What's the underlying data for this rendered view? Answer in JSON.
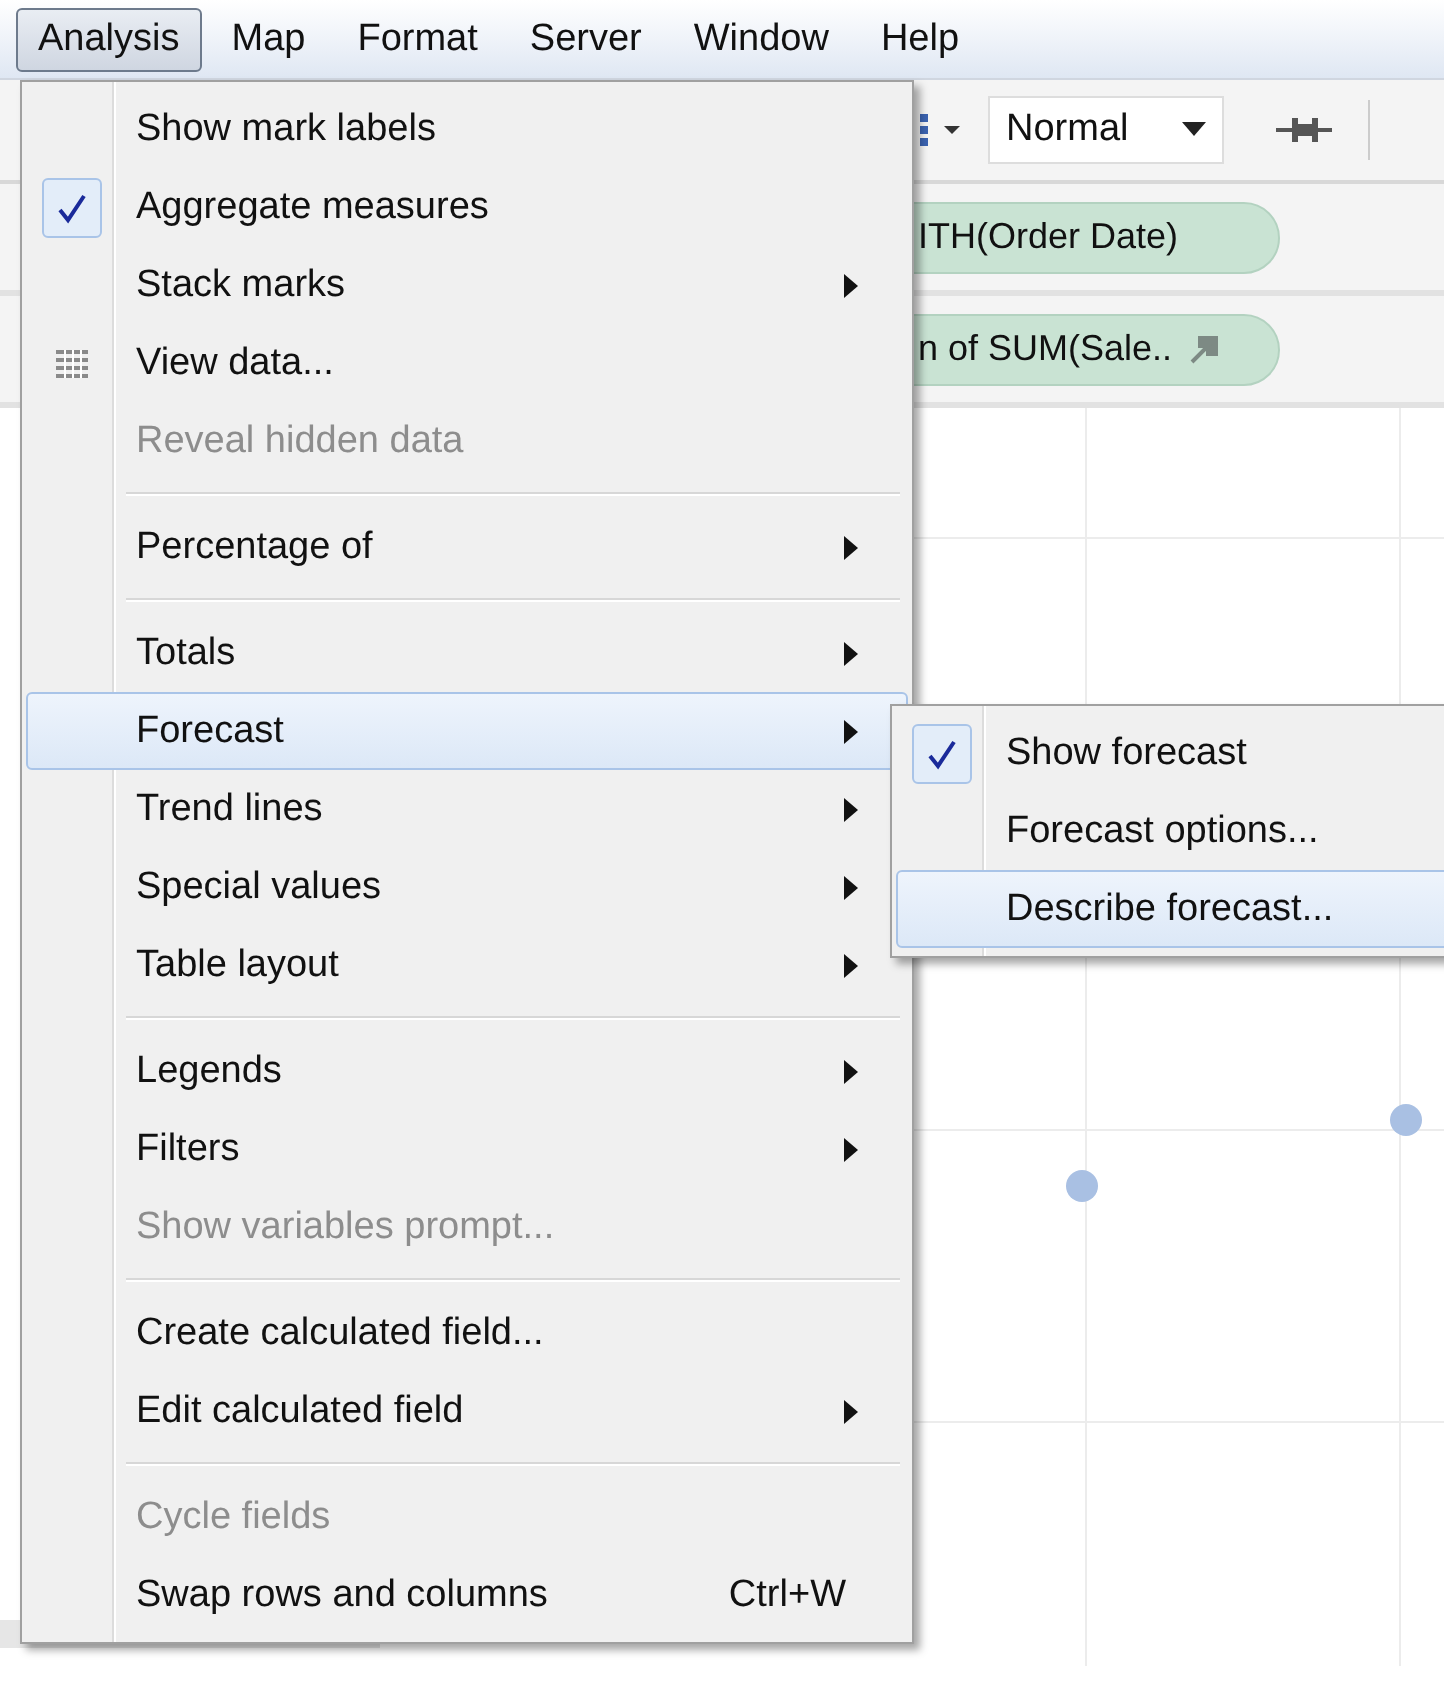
{
  "menubar": [
    {
      "label": "Analysis",
      "selected": true
    },
    {
      "label": "Map",
      "selected": false
    },
    {
      "label": "Format",
      "selected": false
    },
    {
      "label": "Server",
      "selected": false
    },
    {
      "label": "Window",
      "selected": false
    },
    {
      "label": "Help",
      "selected": false
    }
  ],
  "toolbar": {
    "view_mode": "Normal"
  },
  "shelves": [
    {
      "pill": "ITH(Order Date)",
      "has_arrow": false
    },
    {
      "pill": "n of SUM(Sale..",
      "has_arrow": true
    }
  ],
  "menu": {
    "items": [
      {
        "kind": "item",
        "label": "Show mark labels",
        "checked": false,
        "has_icon": false,
        "submenu": false,
        "disabled": false,
        "selected": false
      },
      {
        "kind": "item",
        "label": "Aggregate measures",
        "checked": true,
        "has_icon": false,
        "submenu": false,
        "disabled": false,
        "selected": false
      },
      {
        "kind": "item",
        "label": "Stack marks",
        "checked": false,
        "has_icon": false,
        "submenu": true,
        "disabled": false,
        "selected": false
      },
      {
        "kind": "item",
        "label": "View data...",
        "checked": false,
        "has_icon": true,
        "submenu": false,
        "disabled": false,
        "selected": false
      },
      {
        "kind": "item",
        "label": "Reveal hidden data",
        "checked": false,
        "has_icon": false,
        "submenu": false,
        "disabled": true,
        "selected": false
      },
      {
        "kind": "separator"
      },
      {
        "kind": "item",
        "label": "Percentage of",
        "checked": false,
        "has_icon": false,
        "submenu": true,
        "disabled": false,
        "selected": false
      },
      {
        "kind": "separator"
      },
      {
        "kind": "item",
        "label": "Totals",
        "checked": false,
        "has_icon": false,
        "submenu": true,
        "disabled": false,
        "selected": false
      },
      {
        "kind": "item",
        "label": "Forecast",
        "checked": false,
        "has_icon": false,
        "submenu": true,
        "disabled": false,
        "selected": true
      },
      {
        "kind": "item",
        "label": "Trend lines",
        "checked": false,
        "has_icon": false,
        "submenu": true,
        "disabled": false,
        "selected": false
      },
      {
        "kind": "item",
        "label": "Special values",
        "checked": false,
        "has_icon": false,
        "submenu": true,
        "disabled": false,
        "selected": false
      },
      {
        "kind": "item",
        "label": "Table layout",
        "checked": false,
        "has_icon": false,
        "submenu": true,
        "disabled": false,
        "selected": false
      },
      {
        "kind": "separator"
      },
      {
        "kind": "item",
        "label": "Legends",
        "checked": false,
        "has_icon": false,
        "submenu": true,
        "disabled": false,
        "selected": false
      },
      {
        "kind": "item",
        "label": "Filters",
        "checked": false,
        "has_icon": false,
        "submenu": true,
        "disabled": false,
        "selected": false
      },
      {
        "kind": "item",
        "label": "Show variables prompt...",
        "checked": false,
        "has_icon": false,
        "submenu": false,
        "disabled": true,
        "selected": false
      },
      {
        "kind": "separator"
      },
      {
        "kind": "item",
        "label": "Create calculated field...",
        "checked": false,
        "has_icon": false,
        "submenu": false,
        "disabled": false,
        "selected": false
      },
      {
        "kind": "item",
        "label": "Edit calculated field",
        "checked": false,
        "has_icon": false,
        "submenu": true,
        "disabled": false,
        "selected": false
      },
      {
        "kind": "separator"
      },
      {
        "kind": "item",
        "label": "Cycle fields",
        "checked": false,
        "has_icon": false,
        "submenu": false,
        "disabled": true,
        "selected": false
      },
      {
        "kind": "item",
        "label": "Swap rows and columns",
        "shortcut": "Ctrl+W",
        "checked": false,
        "has_icon": false,
        "submenu": false,
        "disabled": false,
        "selected": false
      }
    ]
  },
  "submenu": {
    "items": [
      {
        "label": "Show forecast",
        "checked": true,
        "selected": false
      },
      {
        "label": "Forecast options...",
        "checked": false,
        "selected": false
      },
      {
        "label": "Describe forecast...",
        "checked": false,
        "selected": true
      }
    ]
  }
}
